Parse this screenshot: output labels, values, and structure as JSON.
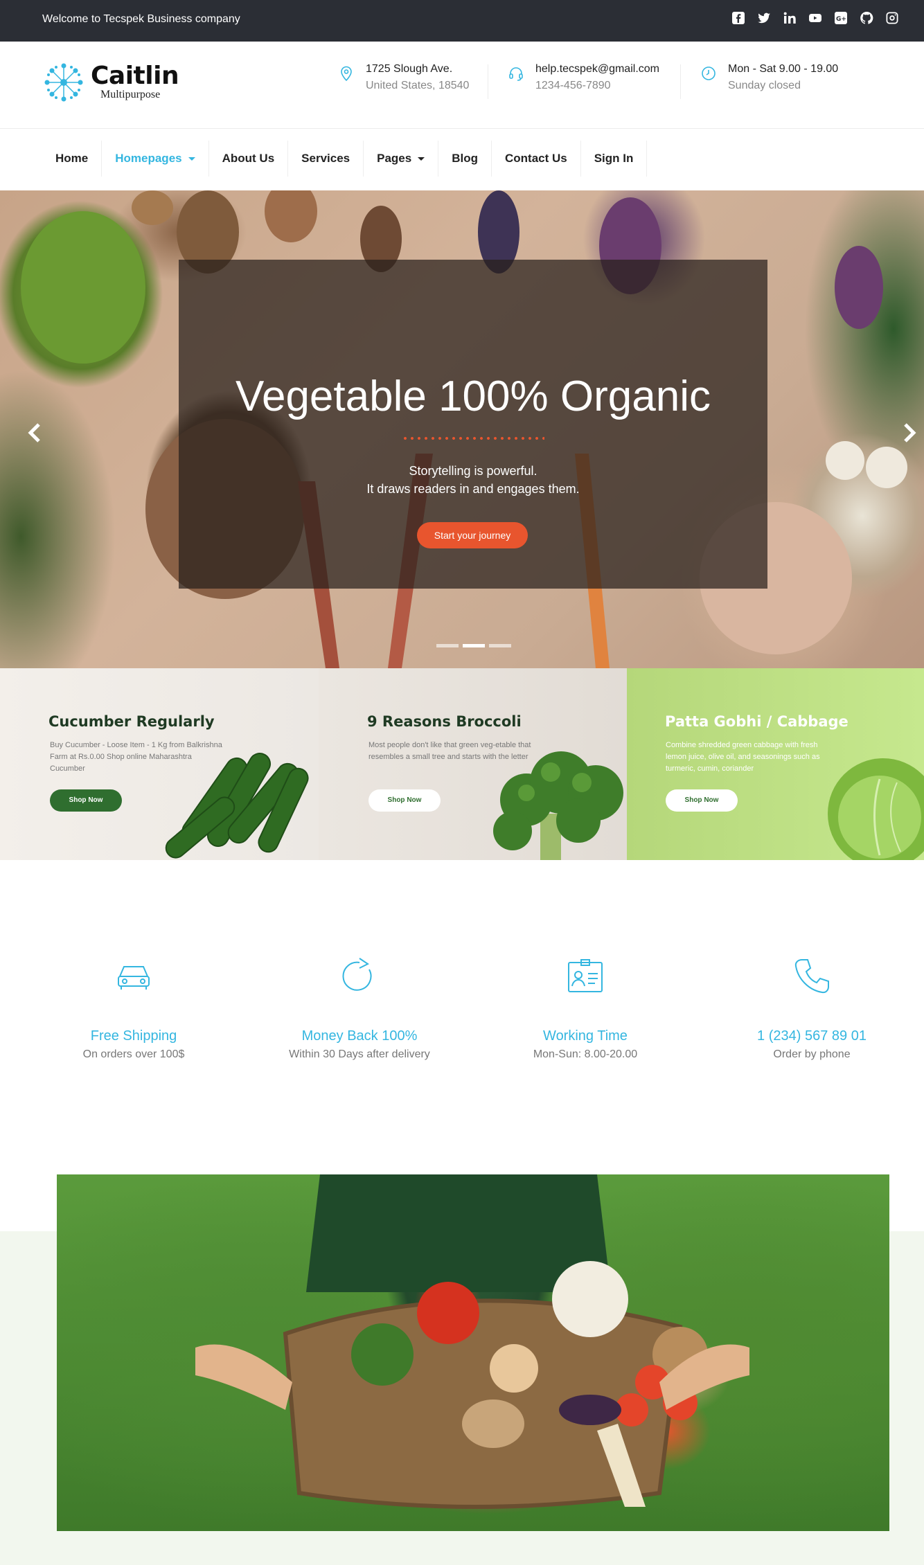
{
  "topbar": {
    "welcome": "Welcome to Tecspek Business company",
    "social_icons": [
      "facebook-icon",
      "twitter-icon",
      "linkedin-icon",
      "youtube-icon",
      "google-plus-icon",
      "github-icon",
      "instagram-icon"
    ]
  },
  "brand": {
    "name": "Caitlin",
    "tagline": "Multipurpose",
    "accent": "#34b6e0"
  },
  "contacts": [
    {
      "icon": "map-pin-icon",
      "line1": "1725 Slough Ave.",
      "line2": "United States, 18540"
    },
    {
      "icon": "headset-icon",
      "line1": "help.tecspek@gmail.com",
      "line2": "1234-456-7890"
    },
    {
      "icon": "clock-icon",
      "line1": "Mon - Sat 9.00 - 19.00",
      "line2": "Sunday closed"
    }
  ],
  "nav": {
    "items": [
      {
        "label": "Home",
        "active": false,
        "dropdown": false
      },
      {
        "label": "Homepages",
        "active": true,
        "dropdown": true
      },
      {
        "label": "About Us",
        "active": false,
        "dropdown": false
      },
      {
        "label": "Services",
        "active": false,
        "dropdown": false
      },
      {
        "label": "Pages",
        "active": false,
        "dropdown": true
      },
      {
        "label": "Blog",
        "active": false,
        "dropdown": false
      },
      {
        "label": "Contact Us",
        "active": false,
        "dropdown": false
      },
      {
        "label": "Sign In",
        "active": false,
        "dropdown": false
      }
    ]
  },
  "hero": {
    "title": "Vegetable 100% Organic",
    "subtitle_line1": "Storytelling is powerful.",
    "subtitle_line2": "It draws readers in and engages them.",
    "button": "Start your journey",
    "button_color": "#e8552e",
    "slides_total": 3,
    "active_slide": 2
  },
  "promos": [
    {
      "title": "Cucumber Regularly",
      "text": "Buy Cucumber - Loose Item - 1 Kg from Balkrishna Farm at Rs.0.00 Shop online Maharashtra Cucumber",
      "button": "Shop Now"
    },
    {
      "title": "9 Reasons Broccoli",
      "text": "Most people don't like that green veg-etable that resembles a small tree and starts with the letter",
      "button": "Shop Now"
    },
    {
      "title": "Patta Gobhi / Cabbage",
      "text": "Combine shredded green cabbage with fresh lemon juice, olive oil, and seasonings such as turmeric, cumin, coriander",
      "button": "Shop Now"
    }
  ],
  "features": [
    {
      "icon": "car-icon",
      "title": "Free Shipping",
      "subtitle": "On orders over 100$"
    },
    {
      "icon": "refresh-icon",
      "title": "Money Back 100%",
      "subtitle": "Within 30 Days after delivery"
    },
    {
      "icon": "id-card-icon",
      "title": "Working Time",
      "subtitle": "Mon-Sun: 8.00-20.00"
    },
    {
      "icon": "phone-icon",
      "title": "1 (234) 567 89 01",
      "subtitle": "Order by phone"
    }
  ]
}
